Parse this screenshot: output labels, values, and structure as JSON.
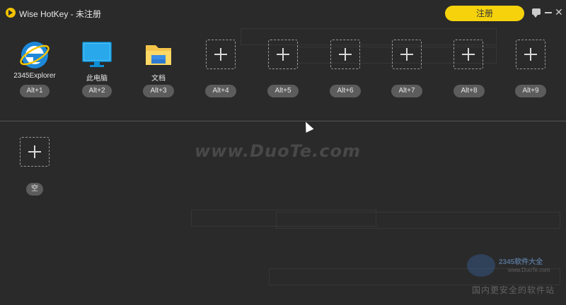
{
  "window": {
    "title": "Wise HotKey - 未注册"
  },
  "header": {
    "register_label": "注册"
  },
  "slots": [
    {
      "name": "2345Explorer",
      "hotkey": "Alt+1",
      "icon": "ie-browser-icon"
    },
    {
      "name": "此电脑",
      "hotkey": "Alt+2",
      "icon": "monitor-icon"
    },
    {
      "name": "文档",
      "hotkey": "Alt+3",
      "icon": "folder-icon"
    },
    {
      "name": "",
      "hotkey": "Alt+4",
      "icon": "add-icon"
    },
    {
      "name": "",
      "hotkey": "Alt+5",
      "icon": "add-icon"
    },
    {
      "name": "",
      "hotkey": "Alt+6",
      "icon": "add-icon"
    },
    {
      "name": "",
      "hotkey": "Alt+7",
      "icon": "add-icon"
    },
    {
      "name": "",
      "hotkey": "Alt+8",
      "icon": "add-icon"
    },
    {
      "name": "",
      "hotkey": "Alt+9",
      "icon": "add-icon"
    }
  ],
  "extra_slot": {
    "hotkey": "空"
  },
  "watermark": {
    "text": "www.DuoTe.com"
  },
  "footer": {
    "brand": "2345软件大全",
    "url": "www.DuoTe.com",
    "text": "国内更安全的软件站"
  },
  "colors": {
    "accent": "#f5d20c",
    "background": "#2a2a2a",
    "pill": "#5c5c5c"
  }
}
